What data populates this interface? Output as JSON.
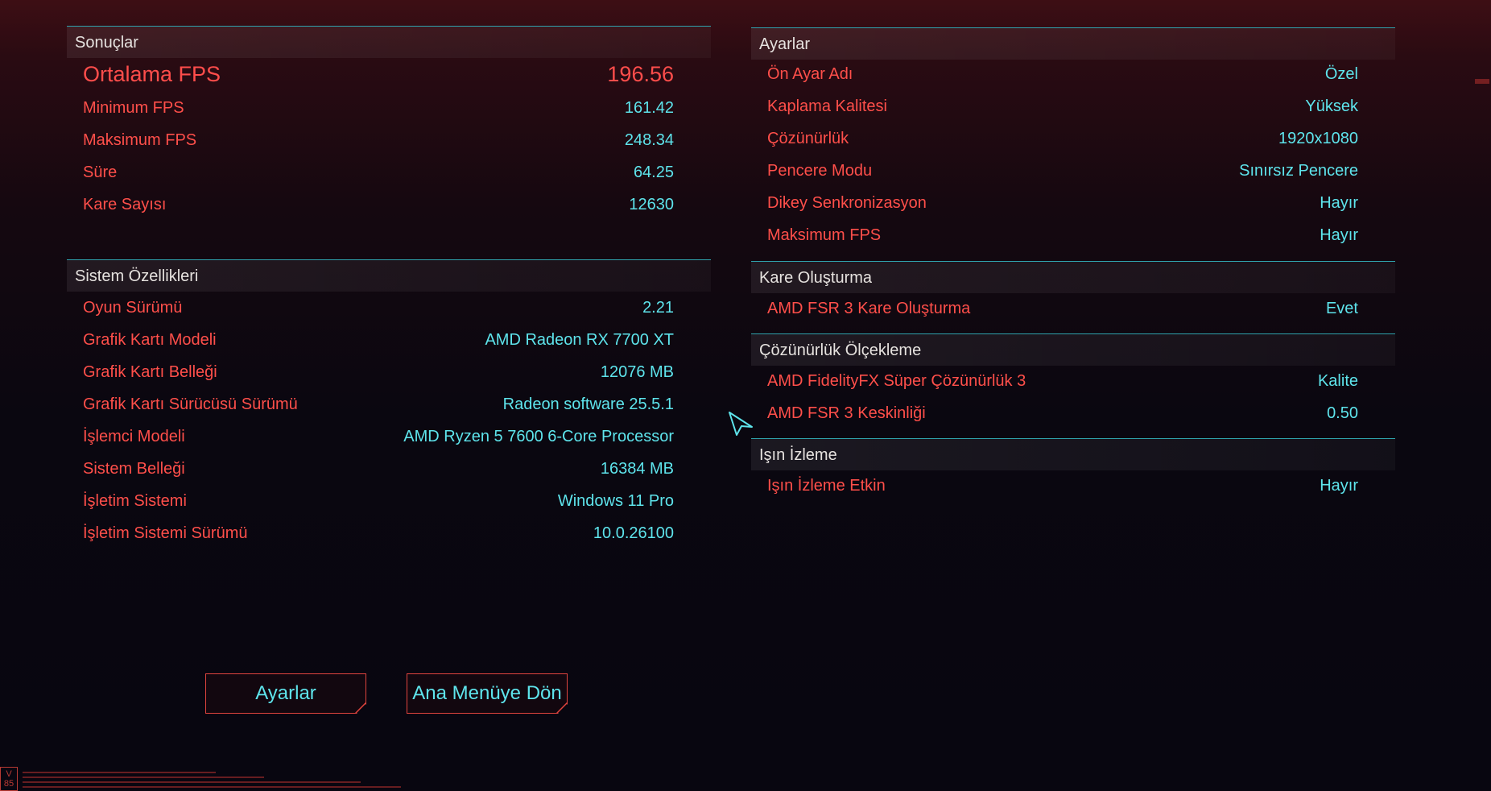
{
  "results": {
    "title": "Sonuçlar",
    "avg_fps": {
      "label": "Ortalama FPS",
      "value": "196.56"
    },
    "rows": [
      {
        "label": "Minimum FPS",
        "value": "161.42"
      },
      {
        "label": "Maksimum FPS",
        "value": "248.34"
      },
      {
        "label": "Süre",
        "value": "64.25"
      },
      {
        "label": "Kare Sayısı",
        "value": "12630"
      }
    ]
  },
  "system": {
    "title": "Sistem Özellikleri",
    "rows": [
      {
        "label": "Oyun Sürümü",
        "value": "2.21"
      },
      {
        "label": "Grafik Kartı Modeli",
        "value": "AMD Radeon RX 7700 XT"
      },
      {
        "label": "Grafik Kartı Belleği",
        "value": "12076 MB"
      },
      {
        "label": "Grafik Kartı Sürücüsü Sürümü",
        "value": "Radeon software 25.5.1"
      },
      {
        "label": "İşlemci Modeli",
        "value": "AMD Ryzen 5 7600 6-Core Processor"
      },
      {
        "label": "Sistem Belleği",
        "value": "16384 MB"
      },
      {
        "label": "İşletim Sistemi",
        "value": "Windows 11 Pro"
      },
      {
        "label": "İşletim Sistemi Sürümü",
        "value": "10.0.26100"
      }
    ]
  },
  "settings": {
    "title": "Ayarlar",
    "rows": [
      {
        "label": "Ön Ayar Adı",
        "value": "Özel"
      },
      {
        "label": "Kaplama Kalitesi",
        "value": "Yüksek"
      },
      {
        "label": "Çözünürlük",
        "value": "1920x1080"
      },
      {
        "label": "Pencere Modu",
        "value": "Sınırsız Pencere"
      },
      {
        "label": "Dikey Senkronizasyon",
        "value": "Hayır"
      },
      {
        "label": "Maksimum FPS",
        "value": "Hayır"
      }
    ]
  },
  "frame_gen": {
    "title": "Kare Oluşturma",
    "rows": [
      {
        "label": "AMD FSR 3 Kare Oluşturma",
        "value": "Evet"
      }
    ]
  },
  "upscaling": {
    "title": "Çözünürlük Ölçekleme",
    "rows": [
      {
        "label": "AMD FidelityFX Süper Çözünürlük 3",
        "value": "Kalite"
      },
      {
        "label": "AMD FSR 3 Keskinliği",
        "value": "0.50"
      }
    ]
  },
  "raytracing": {
    "title": "Işın İzleme",
    "rows": [
      {
        "label": "Işın İzleme Etkin",
        "value": "Hayır"
      }
    ]
  },
  "buttons": {
    "settings": "Ayarlar",
    "main_menu": "Ana Menüye Dön"
  },
  "version_badge": "V\n85",
  "colors": {
    "label_red": "#ff4f4a",
    "value_cyan": "#5ee4ec",
    "divider_teal": "#2fa3ad",
    "button_border": "#e0443e"
  },
  "icons": {
    "cursor": "arrow-cursor-icon"
  }
}
